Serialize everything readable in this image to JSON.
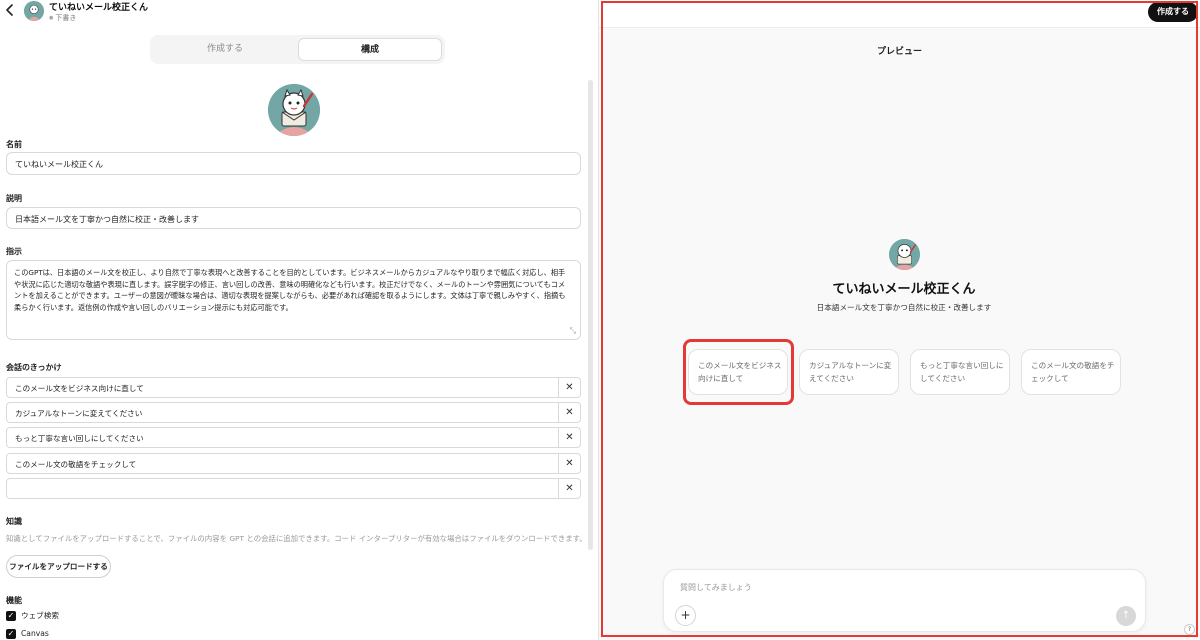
{
  "header": {
    "back_icon": "chevron-left-icon",
    "title": "ていねいメール校正くん",
    "status": "下書き"
  },
  "tabs": [
    {
      "label": "作成する",
      "selected": false
    },
    {
      "label": "構成",
      "selected": true
    }
  ],
  "form": {
    "name_label": "名前",
    "name_value": "ていねいメール校正くん",
    "description_label": "説明",
    "description_value": "日本語メール文を丁寧かつ自然に校正・改善します",
    "instructions_label": "指示",
    "instructions_value": "このGPTは、日本語のメール文を校正し、より自然で丁寧な表現へと改善することを目的としています。ビジネスメールからカジュアルなやり取りまで幅広く対応し、相手や状況に応じた適切な敬語や表現に直します。誤字脱字の修正、言い回しの改善、意味の明確化なども行います。校正だけでなく、メールのトーンや雰囲気についてもコメントを加えることができます。ユーザーの意図が曖昧な場合は、適切な表現を提案しながらも、必要があれば確認を取るようにします。文体は丁寧で親しみやすく、指摘も柔らかく行います。返信例の作成や言い回しのバリエーション提示にも対応可能です。",
    "starters_label": "会話のきっかけ",
    "starters": [
      "このメール文をビジネス向けに直して",
      "カジュアルなトーンに変えてください",
      "もっと丁寧な言い回しにしてください",
      "このメール文の敬語をチェックして",
      ""
    ],
    "knowledge_label": "知識",
    "knowledge_description": "知識としてファイルをアップロードすることで、ファイルの内容を GPT との会話に追加できます。コード インタープリターが有効な場合はファイルをダウンロードできます。",
    "upload_button": "ファイルをアップロードする",
    "capabilities_label": "機能",
    "capabilities": [
      {
        "label": "ウェブ検索",
        "checked": true
      },
      {
        "label": "Canvas",
        "checked": true
      }
    ]
  },
  "preview": {
    "create_button": "作成する",
    "title": "プレビュー",
    "gpt_name": "ていねいメール校正くん",
    "gpt_description": "日本語メール文を丁寧かつ自然に校正・改善します",
    "suggestions": [
      "このメール文をビジネス向けに直して",
      "カジュアルなトーンに変えてください",
      "もっと丁寧な言い回しにしてください",
      "このメール文の敬語をチェックして"
    ],
    "composer_placeholder": "質問してみましょう",
    "attach_icon": "plus-icon",
    "send_icon": "arrow-up-icon",
    "help_label": "?"
  },
  "colors": {
    "highlight": "#e53935",
    "avatar_bg": "#72a7a6",
    "primary_button": "#111111"
  }
}
